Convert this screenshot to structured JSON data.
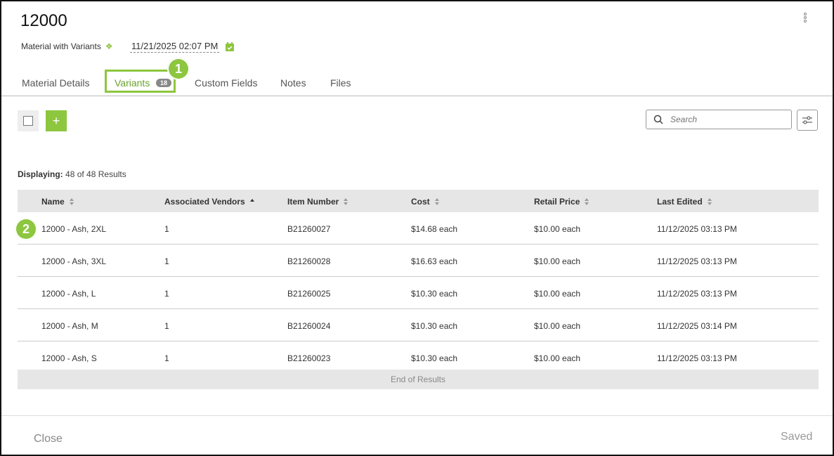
{
  "header": {
    "title": "12000",
    "subtitle": "Material with Variants",
    "subtitle_icon": "diamond-icon",
    "date": "11/21/2025 02:07 PM",
    "accent_color": "#8dc63f"
  },
  "tabs": [
    {
      "label": "Material Details"
    },
    {
      "label": "Variants",
      "badge": "18",
      "active": true
    },
    {
      "label": "Custom Fields"
    },
    {
      "label": "Notes"
    },
    {
      "label": "Files"
    }
  ],
  "callouts": [
    "1",
    "2"
  ],
  "search": {
    "placeholder": "Search"
  },
  "results": {
    "prefix": "Displaying:",
    "text": "48 of 48 Results"
  },
  "table": {
    "columns": [
      "Name",
      "Associated Vendors",
      "Item Number",
      "Cost",
      "Retail Price",
      "Last Edited"
    ],
    "rows": [
      [
        "12000 - Ash, 2XL",
        "1",
        "B21260027",
        "$14.68 each",
        "$10.00 each",
        "11/12/2025 03:13 PM"
      ],
      [
        "12000 - Ash, 3XL",
        "1",
        "B21260028",
        "$16.63 each",
        "$10.00 each",
        "11/12/2025 03:13 PM"
      ],
      [
        "12000 - Ash, L",
        "1",
        "B21260025",
        "$10.30 each",
        "$10.00 each",
        "11/12/2025 03:13 PM"
      ],
      [
        "12000 - Ash, M",
        "1",
        "B21260024",
        "$10.30 each",
        "$10.00 each",
        "11/12/2025 03:14 PM"
      ],
      [
        "12000 - Ash, S",
        "1",
        "B21260023",
        "$10.30 each",
        "$10.00 each",
        "11/12/2025 03:13 PM"
      ]
    ],
    "end_text": "End of Results"
  },
  "footer": {
    "close_label": "Close",
    "status": "Saved"
  }
}
